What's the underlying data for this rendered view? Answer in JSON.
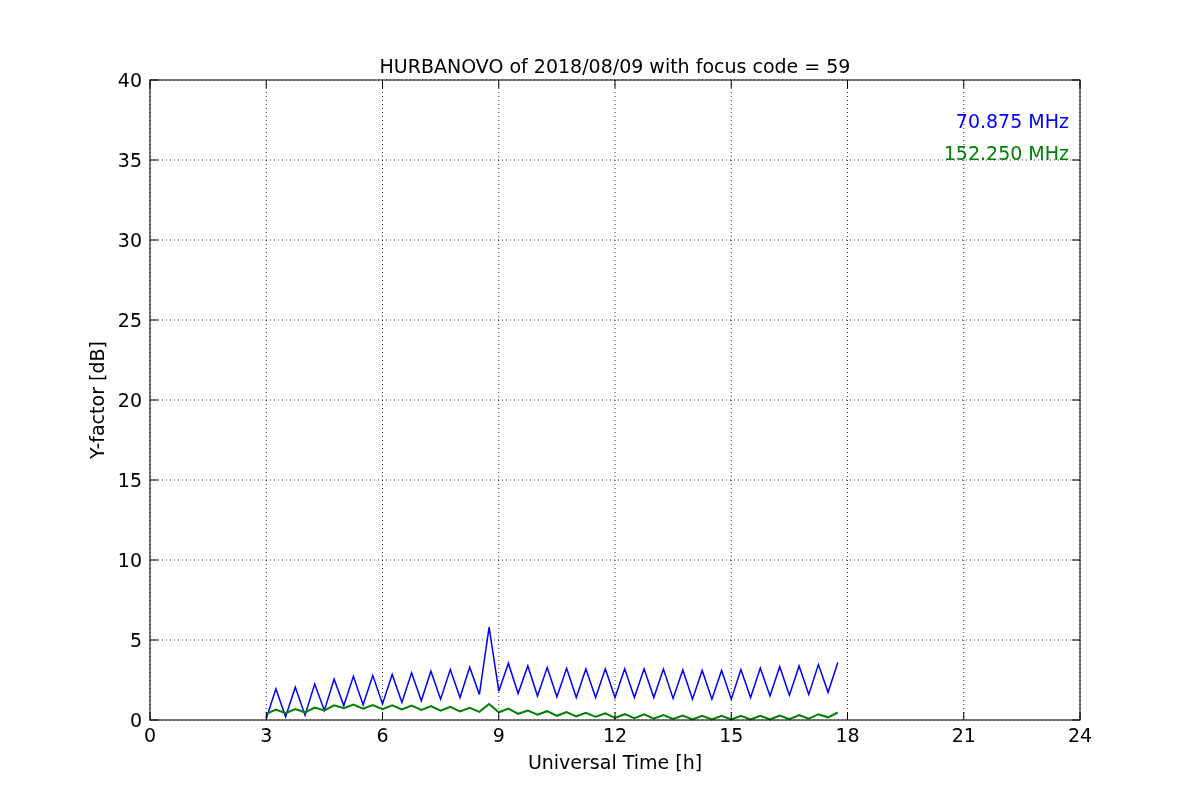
{
  "chart": {
    "chart_data": {
      "type": "line",
      "title": "HURBANOVO of 2018/08/09 with focus code = 59",
      "xlabel": "Universal Time [h]",
      "ylabel": "Y-factor [dB]",
      "x": [
        3,
        3.25,
        3.5,
        3.75,
        4,
        4.25,
        4.5,
        4.75,
        5,
        5.25,
        5.5,
        5.75,
        6,
        6.25,
        6.5,
        6.75,
        7,
        7.25,
        7.5,
        7.75,
        8,
        8.25,
        8.5,
        8.75,
        9,
        9.25,
        9.5,
        9.75,
        10,
        10.25,
        10.5,
        10.75,
        11,
        11.25,
        11.5,
        11.75,
        12,
        12.25,
        12.5,
        12.75,
        13,
        13.25,
        13.5,
        13.75,
        14,
        14.25,
        14.5,
        14.75,
        15,
        15.25,
        15.5,
        15.75,
        16,
        16.25,
        16.5,
        16.75,
        17,
        17.25,
        17.5,
        17.75
      ],
      "series": [
        {
          "name": "70.875 MHz",
          "color": "#0000ff",
          "values": [
            0.1,
            1.95,
            0.2,
            2.05,
            0.3,
            2.25,
            0.6,
            2.55,
            0.9,
            2.73,
            0.95,
            2.78,
            1.0,
            2.85,
            1.1,
            2.95,
            1.2,
            3.05,
            1.3,
            3.15,
            1.4,
            3.3,
            1.6,
            5.8,
            1.8,
            3.55,
            1.65,
            3.38,
            1.5,
            3.28,
            1.45,
            3.23,
            1.4,
            3.2,
            1.4,
            3.2,
            1.4,
            3.2,
            1.4,
            3.2,
            1.4,
            3.18,
            1.35,
            3.13,
            1.3,
            3.1,
            1.3,
            3.1,
            1.3,
            3.15,
            1.4,
            3.25,
            1.5,
            3.33,
            1.55,
            3.38,
            1.6,
            3.47,
            1.73,
            3.6
          ]
        },
        {
          "name": "152.250 MHz",
          "color": "#008000",
          "values": [
            0.38,
            0.65,
            0.43,
            0.69,
            0.48,
            0.78,
            0.6,
            0.91,
            0.73,
            0.96,
            0.71,
            0.93,
            0.68,
            0.91,
            0.66,
            0.9,
            0.63,
            0.86,
            0.58,
            0.82,
            0.53,
            0.76,
            0.51,
            1.0,
            0.48,
            0.71,
            0.39,
            0.59,
            0.33,
            0.55,
            0.26,
            0.5,
            0.23,
            0.45,
            0.2,
            0.42,
            0.13,
            0.36,
            0.11,
            0.35,
            0.08,
            0.31,
            0.06,
            0.28,
            0.03,
            0.27,
            0.03,
            0.27,
            0.03,
            0.27,
            0.03,
            0.27,
            0.03,
            0.28,
            0.05,
            0.31,
            0.08,
            0.36,
            0.17,
            0.47
          ]
        }
      ],
      "xlim": [
        0,
        24
      ],
      "ylim": [
        0,
        40
      ],
      "xticks": [
        0,
        3,
        6,
        9,
        12,
        15,
        18,
        21,
        24
      ],
      "yticks": [
        0,
        5,
        10,
        15,
        20,
        25,
        30,
        35,
        40
      ],
      "grid": true
    }
  }
}
